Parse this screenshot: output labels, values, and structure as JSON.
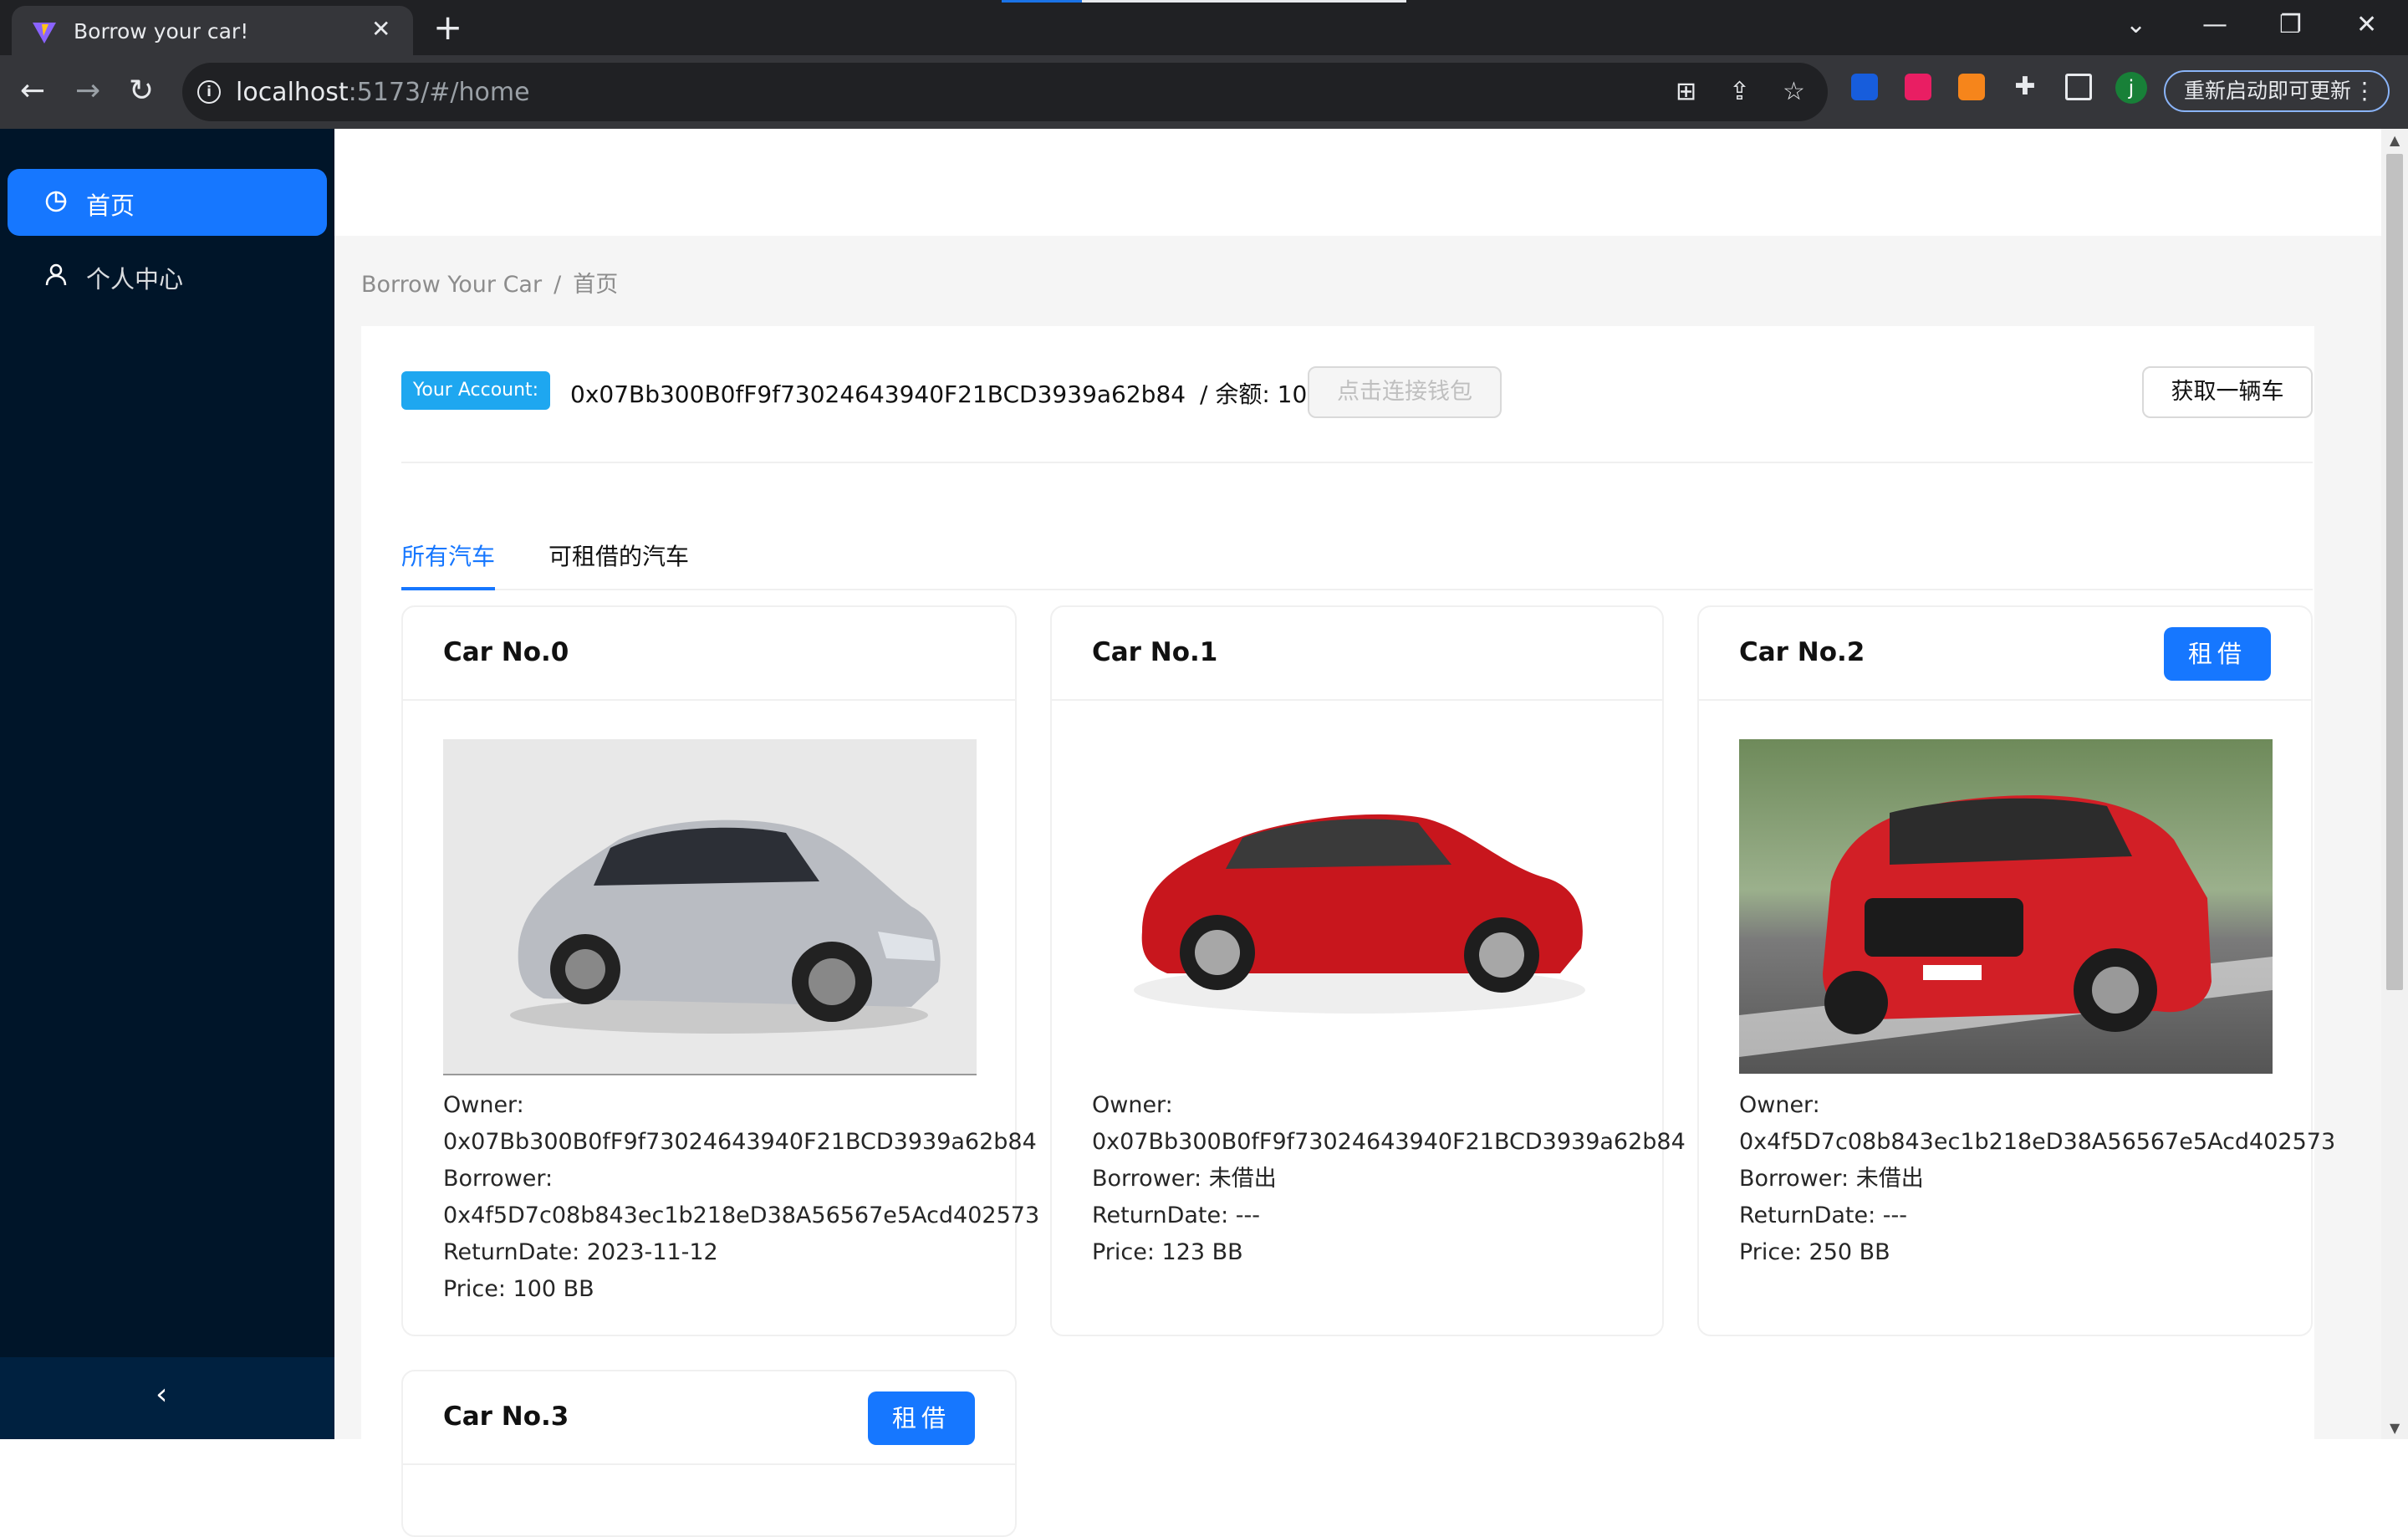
{
  "browser": {
    "tab_title": "Borrow your car!",
    "tab_close": "✕",
    "new_tab": "+",
    "url_host": "localhost",
    "url_rest": ":5173/#/home",
    "update_label": "重新启动即可更新",
    "profile_initial": "j",
    "info_glyph": "i"
  },
  "sidebar": {
    "items": [
      {
        "label": "首页",
        "icon": "pie-chart-icon",
        "active": true
      },
      {
        "label": "个人中心",
        "icon": "user-icon",
        "active": false
      }
    ],
    "collapse_glyph": "‹"
  },
  "breadcrumb": {
    "root": "Borrow Your Car",
    "separator": "/",
    "current": "首页"
  },
  "account": {
    "tag_label": "Your Account:",
    "address": "0x07Bb300B0fF9f73024643940F21BCD3939a62b84",
    "balance_text": "/ 余额: 10100 BB",
    "connect_label": "点击连接钱包",
    "get_car_label": "获取一辆车"
  },
  "tabs": {
    "all_cars": "所有汽车",
    "available_cars": "可租借的汽车"
  },
  "cars": [
    {
      "title": "Car No.0",
      "owner_label": "Owner:",
      "owner": "0x07Bb300B0fF9f73024643940F21BCD3939a62b84",
      "borrower_label": "Borrower:",
      "borrower": "0x4f5D7c08b843ec1b218eD38A56567e5Acd402573",
      "return_date": "ReturnDate: 2023-11-12",
      "price": "Price: 100 BB"
    },
    {
      "title": "Car No.1",
      "owner_label": "Owner:",
      "owner": "0x07Bb300B0fF9f73024643940F21BCD3939a62b84",
      "borrower": "Borrower: 未借出",
      "return_date": "ReturnDate: ---",
      "price": "Price: 123 BB"
    },
    {
      "title": "Car No.2",
      "rent_label": "租借",
      "owner_label": "Owner:",
      "owner": "0x4f5D7c08b843ec1b218eD38A56567e5Acd402573",
      "borrower": "Borrower: 未借出",
      "return_date": "ReturnDate: ---",
      "price": "Price: 250 BB"
    },
    {
      "title": "Car No.3",
      "rent_label": "租借"
    }
  ],
  "colors": {
    "primary": "#1677ff",
    "sidebar_bg": "#001529",
    "tag_bg": "#1ea7f0"
  }
}
